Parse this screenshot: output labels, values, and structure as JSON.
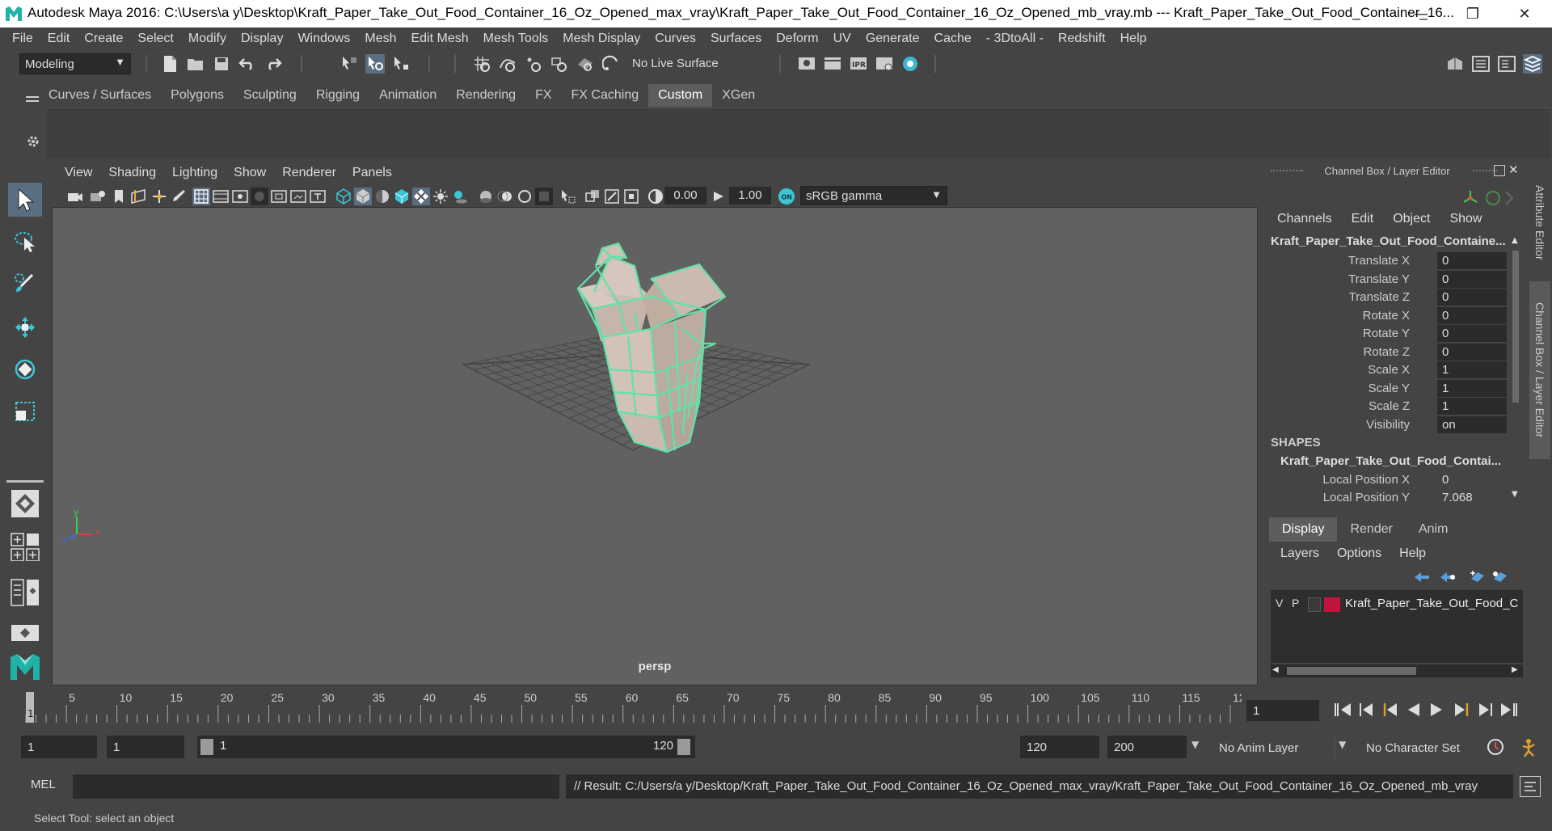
{
  "window": {
    "title": "Autodesk Maya 2016: C:\\Users\\a y\\Desktop\\Kraft_Paper_Take_Out_Food_Container_16_Oz_Opened_max_vray\\Kraft_Paper_Take_Out_Food_Container_16_Oz_Opened_mb_vray.mb   ---   Kraft_Paper_Take_Out_Food_Container_16...",
    "minimize": "—",
    "restore": "❐",
    "close": "✕"
  },
  "menubar": [
    "File",
    "Edit",
    "Create",
    "Select",
    "Modify",
    "Display",
    "Windows",
    "Mesh",
    "Edit Mesh",
    "Mesh Tools",
    "Mesh Display",
    "Curves",
    "Surfaces",
    "Deform",
    "UV",
    "Generate",
    "Cache",
    "- 3DtoAll -",
    "Redshift",
    "Help"
  ],
  "toolbar": {
    "mode_menu": "Modeling",
    "live_surface": "No Live Surface"
  },
  "shelf": {
    "tabs": [
      "Curves / Surfaces",
      "Polygons",
      "Sculpting",
      "Rigging",
      "Animation",
      "Rendering",
      "FX",
      "FX Caching",
      "Custom",
      "XGen"
    ],
    "active_tab": "Custom"
  },
  "viewport": {
    "menu": [
      "View",
      "Shading",
      "Lighting",
      "Show",
      "Renderer",
      "Panels"
    ],
    "exposure": "0.00",
    "gamma": "1.00",
    "color_space": "sRGB gamma",
    "camera_label": "persp",
    "axis": {
      "x": "x",
      "y": "y",
      "z": "z"
    }
  },
  "channel_box": {
    "title": "Channel Box / Layer Editor",
    "menu": [
      "Channels",
      "Edit",
      "Object",
      "Show"
    ],
    "object_name": "Kraft_Paper_Take_Out_Food_Containe...",
    "attributes": [
      {
        "label": "Translate X",
        "value": "0"
      },
      {
        "label": "Translate Y",
        "value": "0"
      },
      {
        "label": "Translate Z",
        "value": "0"
      },
      {
        "label": "Rotate X",
        "value": "0"
      },
      {
        "label": "Rotate Y",
        "value": "0"
      },
      {
        "label": "Rotate Z",
        "value": "0"
      },
      {
        "label": "Scale X",
        "value": "1"
      },
      {
        "label": "Scale Y",
        "value": "1"
      },
      {
        "label": "Scale Z",
        "value": "1"
      },
      {
        "label": "Visibility",
        "value": "on"
      }
    ],
    "shapes_header": "SHAPES",
    "shape_name": "Kraft_Paper_Take_Out_Food_Contai...",
    "shape_attributes": [
      {
        "label": "Local Position X",
        "value": "0"
      },
      {
        "label": "Local Position Y",
        "value": "7.068"
      }
    ]
  },
  "layer_editor": {
    "tabs": [
      "Display",
      "Render",
      "Anim"
    ],
    "active_tab": "Display",
    "menu": [
      "Layers",
      "Options",
      "Help"
    ],
    "layer": {
      "v": "V",
      "p": "P",
      "name": "Kraft_Paper_Take_Out_Food_C",
      "color": "#c0143c"
    }
  },
  "side_tabs": [
    "Attribute Editor",
    "Channel Box / Layer Editor"
  ],
  "timeline": {
    "ticks": [
      "5",
      "10",
      "15",
      "20",
      "25",
      "30",
      "35",
      "40",
      "45",
      "50",
      "55",
      "60",
      "65",
      "70",
      "75",
      "80",
      "85",
      "90",
      "95",
      "100",
      "105",
      "110",
      "115",
      "12"
    ],
    "current_frame_marker": "1",
    "current_frame": "1"
  },
  "range": {
    "start_time": "1",
    "playback_start": "1",
    "slider_start": "1",
    "slider_end": "120",
    "playback_end": "120",
    "end_time": "200",
    "anim_layer": "No Anim Layer",
    "character_set": "No Character Set"
  },
  "command": {
    "language": "MEL",
    "result": "// Result: C:/Users/a y/Desktop/Kraft_Paper_Take_Out_Food_Container_16_Oz_Opened_max_vray/Kraft_Paper_Take_Out_Food_Container_16_Oz_Opened_mb_vray"
  },
  "help_line": "Select Tool: select an object",
  "colors": {
    "accent": "#5a6e82",
    "wireframe": "#5fe3a8",
    "maya_logo": "#1fb3a8"
  }
}
